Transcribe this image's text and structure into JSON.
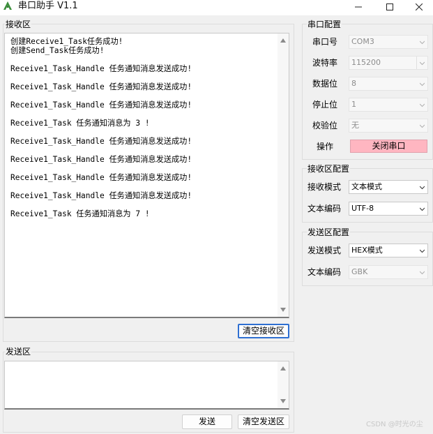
{
  "window": {
    "title": "串口助手 V1.1",
    "minimize_icon": "minimize-icon",
    "maximize_icon": "maximize-icon",
    "close_icon": "close-icon",
    "app_icon": "app-logo-icon"
  },
  "receive": {
    "group_label": "接收区",
    "lines": [
      "创建Receive1_Task任务成功!",
      "创建Send_Task任务成功!",
      "",
      "Receive1_Task_Handle 任务通知消息发送成功!",
      "",
      "Receive1_Task_Handle 任务通知消息发送成功!",
      "",
      "Receive1_Task_Handle 任务通知消息发送成功!",
      "",
      "Receive1_Task 任务通知消息为 3 !",
      "",
      "Receive1_Task_Handle 任务通知消息发送成功!",
      "",
      "Receive1_Task_Handle 任务通知消息发送成功!",
      "",
      "Receive1_Task_Handle 任务通知消息发送成功!",
      "",
      "Receive1_Task_Handle 任务通知消息发送成功!",
      "",
      "Receive1_Task 任务通知消息为 7 !"
    ],
    "clear_button": "清空接收区"
  },
  "send": {
    "group_label": "发送区",
    "text": "",
    "send_button": "发送",
    "clear_button": "清空发送区"
  },
  "serial_config": {
    "group_label": "串口配置",
    "port_label": "串口号",
    "port_value": "COM3",
    "baud_label": "波特率",
    "baud_value": "115200",
    "databits_label": "数据位",
    "databits_value": "8",
    "stopbits_label": "停止位",
    "stopbits_value": "1",
    "parity_label": "校验位",
    "parity_value": "无",
    "operation_label": "操作",
    "close_port_button": "关闭串口"
  },
  "receive_config": {
    "group_label": "接收区配置",
    "mode_label": "接收模式",
    "mode_value": "文本模式",
    "encoding_label": "文本编码",
    "encoding_value": "UTF-8"
  },
  "send_config": {
    "group_label": "发送区配置",
    "mode_label": "发送模式",
    "mode_value": "HEX模式",
    "encoding_label": "文本编码",
    "encoding_value": "GBK"
  },
  "watermark": "CSDN @时光の尘",
  "colors": {
    "close_port_bg": "#ffb6c1",
    "focus_border": "#2e6fd1",
    "window_bg": "#f0f0f0"
  }
}
